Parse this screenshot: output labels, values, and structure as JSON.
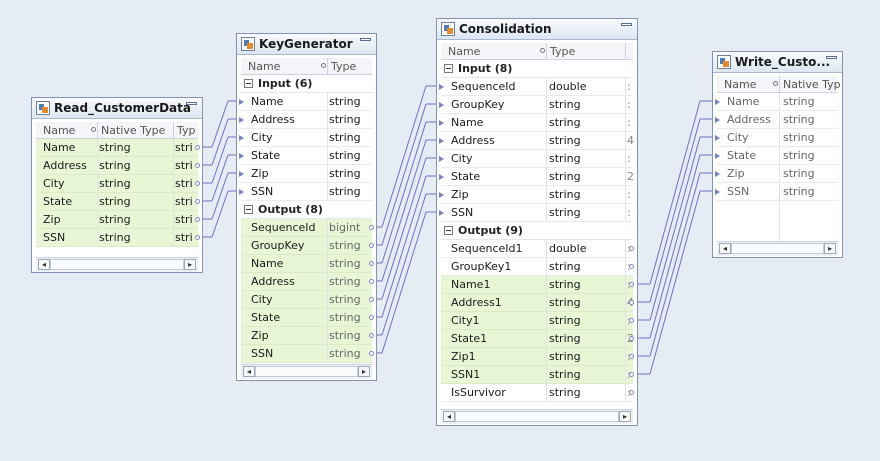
{
  "colors": {
    "canvas": "#e6ecf3",
    "row_highlight": "#e8f6d6",
    "link": "#6f6fc4",
    "border": "#8094b1"
  },
  "transforms": {
    "read": {
      "title": "Read_CustomerData",
      "icon": "read-source-icon",
      "headers": [
        "Name",
        "Native Type",
        "Typ"
      ],
      "rows": [
        {
          "name": "Name",
          "type": "string",
          "t2": "stri"
        },
        {
          "name": "Address",
          "type": "string",
          "t2": "stri"
        },
        {
          "name": "City",
          "type": "string",
          "t2": "stri"
        },
        {
          "name": "State",
          "type": "string",
          "t2": "stri"
        },
        {
          "name": "Zip",
          "type": "string",
          "t2": "stri"
        },
        {
          "name": "SSN",
          "type": "string",
          "t2": "stri"
        }
      ]
    },
    "keygen": {
      "title": "KeyGenerator",
      "icon": "key-generator-icon",
      "headers": [
        "Name",
        "Type"
      ],
      "input_group": "Input (6)",
      "inputs": [
        {
          "name": "Name",
          "type": "string"
        },
        {
          "name": "Address",
          "type": "string"
        },
        {
          "name": "City",
          "type": "string"
        },
        {
          "name": "State",
          "type": "string"
        },
        {
          "name": "Zip",
          "type": "string"
        },
        {
          "name": "SSN",
          "type": "string"
        }
      ],
      "output_group": "Output (8)",
      "outputs": [
        {
          "name": "SequenceId",
          "type": "bigint"
        },
        {
          "name": "GroupKey",
          "type": "string"
        },
        {
          "name": "Name",
          "type": "string"
        },
        {
          "name": "Address",
          "type": "string"
        },
        {
          "name": "City",
          "type": "string"
        },
        {
          "name": "State",
          "type": "string"
        },
        {
          "name": "Zip",
          "type": "string"
        },
        {
          "name": "SSN",
          "type": "string"
        }
      ]
    },
    "consolidation": {
      "title": "Consolidation",
      "icon": "consolidation-icon",
      "headers": [
        "Name",
        "Type"
      ],
      "input_group": "Input (8)",
      "inputs": [
        {
          "name": "SequenceId",
          "type": "double",
          "p": ":"
        },
        {
          "name": "GroupKey",
          "type": "string",
          "p": ":"
        },
        {
          "name": "Name",
          "type": "string",
          "p": ":"
        },
        {
          "name": "Address",
          "type": "string",
          "p": "4"
        },
        {
          "name": "City",
          "type": "string",
          "p": ":"
        },
        {
          "name": "State",
          "type": "string",
          "p": "2"
        },
        {
          "name": "Zip",
          "type": "string",
          "p": ":"
        },
        {
          "name": "SSN",
          "type": "string",
          "p": ":"
        }
      ],
      "output_group": "Output (9)",
      "outputs": [
        {
          "name": "SequenceId1",
          "type": "double",
          "p": ":"
        },
        {
          "name": "GroupKey1",
          "type": "string",
          "p": ":"
        },
        {
          "name": "Name1",
          "type": "string",
          "p": ":"
        },
        {
          "name": "Address1",
          "type": "string",
          "p": "4"
        },
        {
          "name": "City1",
          "type": "string",
          "p": ":"
        },
        {
          "name": "State1",
          "type": "string",
          "p": "2"
        },
        {
          "name": "Zip1",
          "type": "string",
          "p": ":"
        },
        {
          "name": "SSN1",
          "type": "string",
          "p": ":"
        },
        {
          "name": "IsSurvivor",
          "type": "string",
          "p": ":"
        }
      ]
    },
    "write": {
      "title": "Write_Custo...",
      "icon": "write-target-icon",
      "headers": [
        "Name",
        "Native Typ"
      ],
      "rows": [
        {
          "name": "Name",
          "type": "string"
        },
        {
          "name": "Address",
          "type": "string"
        },
        {
          "name": "City",
          "type": "string"
        },
        {
          "name": "State",
          "type": "string"
        },
        {
          "name": "Zip",
          "type": "string"
        },
        {
          "name": "SSN",
          "type": "string"
        }
      ]
    }
  },
  "scroll": {
    "left_arrow": "◂",
    "right_arrow": "▸"
  }
}
